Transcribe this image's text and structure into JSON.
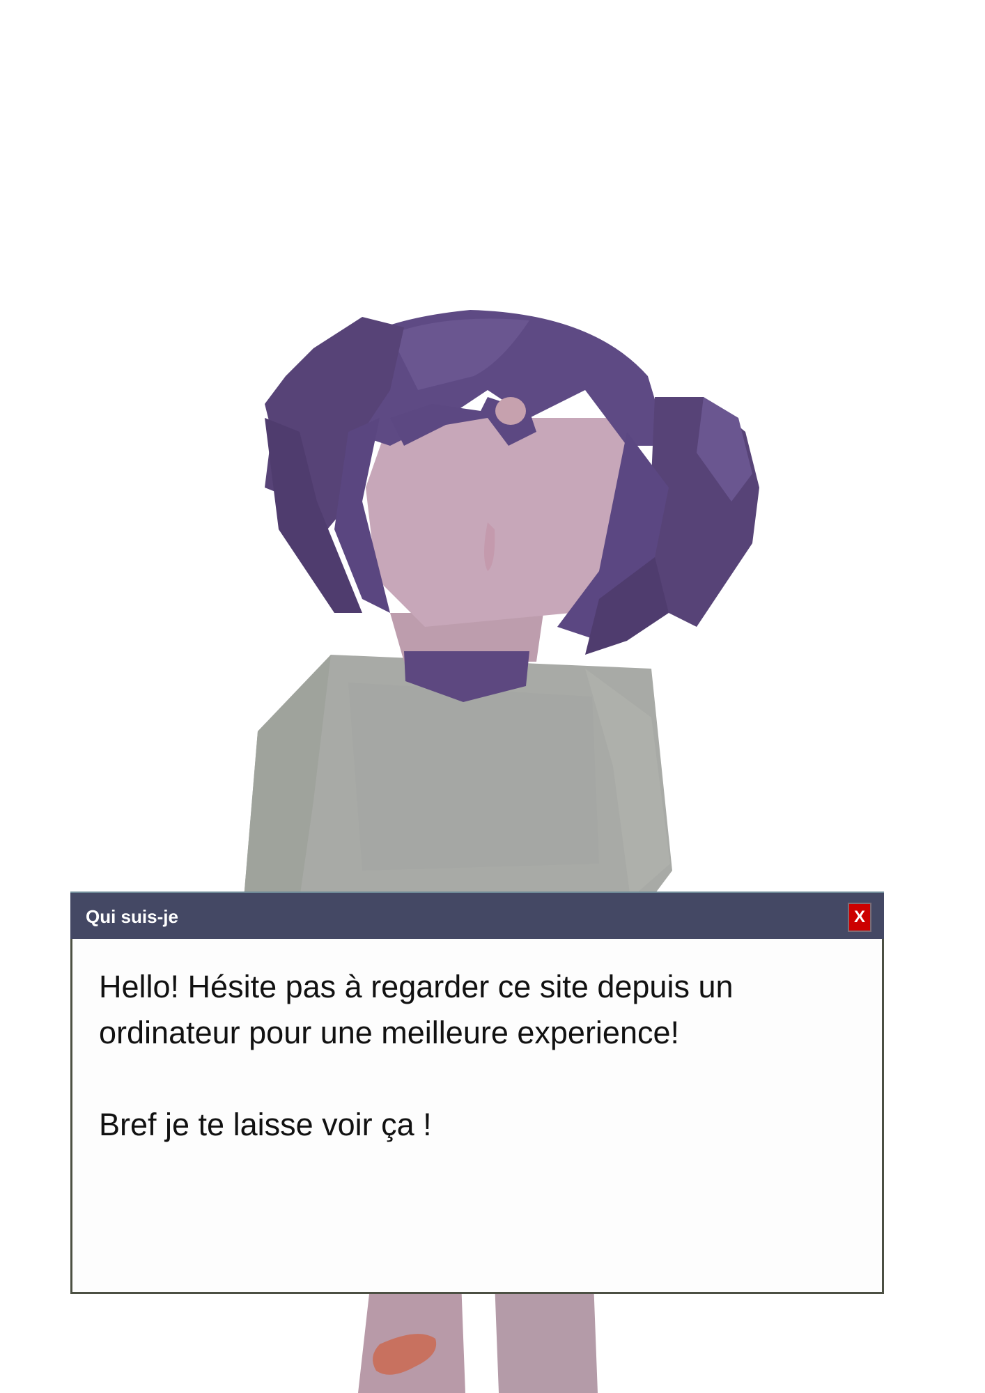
{
  "dialog": {
    "title": "Qui suis-je",
    "close_label": "X",
    "line1": "Hello! Hésite pas à regarder ce site depuis un",
    "line2": "ordinateur pour une meilleure experience!",
    "line3": "Bref je te laisse voir ça !"
  },
  "colors": {
    "titlebar": "#444864",
    "close_button": "#cc0000",
    "hair": "#5b4680",
    "skin": "#c9a5b6",
    "shirt": "#a9ada6"
  }
}
